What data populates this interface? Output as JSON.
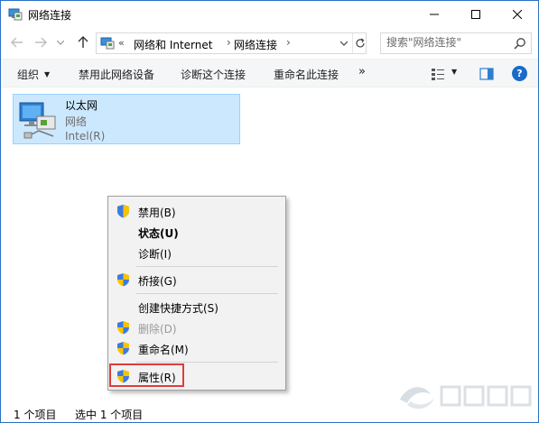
{
  "window": {
    "title": "网络连接"
  },
  "address": {
    "overflow_chevron": "«",
    "crumbs": [
      "网络和 Internet",
      "网络连接"
    ]
  },
  "search": {
    "placeholder": "搜索\"网络连接\""
  },
  "commands": {
    "organize": "组织",
    "disable_device": "禁用此网络设备",
    "diagnose": "诊断这个连接",
    "rename": "重命名此连接",
    "more": "»",
    "help": "?"
  },
  "adapter": {
    "name": "以太网",
    "status": "网络",
    "device": "Intel(R)"
  },
  "context_menu": {
    "items": [
      {
        "label": "禁用(B)",
        "shield": true
      },
      {
        "label": "状态(U)",
        "bold": true
      },
      {
        "label": "诊断(I)"
      },
      {
        "label": "桥接(G)",
        "shield": true
      },
      {
        "label": "创建快捷方式(S)"
      },
      {
        "label": "删除(D)",
        "shield": true,
        "disabled": true
      },
      {
        "label": "重命名(M)",
        "shield": true
      },
      {
        "label": "属性(R)",
        "shield": true,
        "highlighted": true
      }
    ]
  },
  "statusbar": {
    "count": "1 个项目",
    "selected": "选中 1 个项目"
  },
  "colors": {
    "selection_bg": "#cce8ff",
    "highlight_outline": "#e03b3b",
    "accent": "#1b6ac9"
  }
}
